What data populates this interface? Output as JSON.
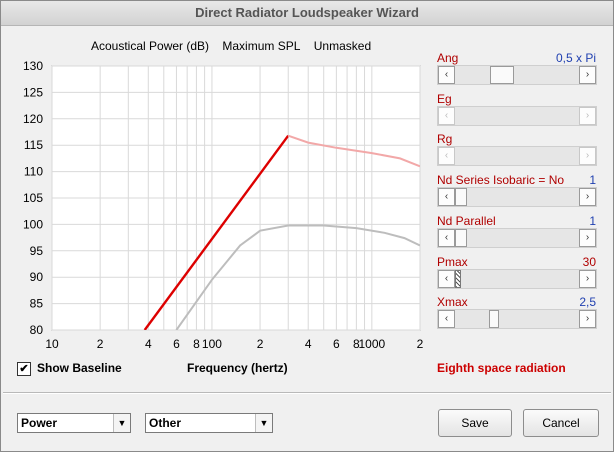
{
  "window": {
    "title": "Direct Radiator Loudspeaker Wizard"
  },
  "chart_header": {
    "item1": "Acoustical Power (dB)",
    "item2": "Maximum SPL",
    "item3": "Unmasked"
  },
  "controls": [
    {
      "label": "Ang",
      "value": "0,5 x Pi",
      "slider_position": 0.35,
      "enabled": true
    },
    {
      "label": "Eg",
      "value": "",
      "slider_position": null,
      "enabled": false
    },
    {
      "label": "Rg",
      "value": "",
      "slider_position": null,
      "enabled": false
    },
    {
      "label": "Nd Series   Isobaric = No",
      "value": "1",
      "slider_position": 0.0,
      "enabled": true
    },
    {
      "label": "Nd  Parallel",
      "value": "1",
      "slider_position": 0.0,
      "enabled": true
    },
    {
      "label": "Pmax",
      "value": "30",
      "slider_position": 0.0,
      "enabled": true
    },
    {
      "label": "Xmax",
      "value": "2,5",
      "slider_position": 0.3,
      "enabled": true
    }
  ],
  "show_baseline": {
    "label": "Show Baseline",
    "checked": true,
    "check_glyph": "✔"
  },
  "xaxis_label": "Frequency (hertz)",
  "radiation_text": "Eighth space radiation",
  "dropdowns": {
    "left": "Power",
    "right": "Other"
  },
  "buttons": {
    "save": "Save",
    "cancel": "Cancel"
  },
  "colors": {
    "red_curve": "#dd0000",
    "pink_curve": "#f2a8a8",
    "gray_curve": "#bdbdbd",
    "label_red": "#b00000",
    "value_blue": "#1f3fb0"
  },
  "chart_data": {
    "type": "line",
    "xscale": "log",
    "xlim": [
      10,
      2000
    ],
    "ylim": [
      80,
      130
    ],
    "yticks": [
      80,
      85,
      90,
      95,
      100,
      105,
      110,
      115,
      120,
      125,
      130
    ],
    "xtick_labels": [
      {
        "x": 10,
        "label": "10"
      },
      {
        "x": 20,
        "label": "2"
      },
      {
        "x": 40,
        "label": "4"
      },
      {
        "x": 60,
        "label": "6"
      },
      {
        "x": 80,
        "label": "8"
      },
      {
        "x": 100,
        "label": "100"
      },
      {
        "x": 200,
        "label": "2"
      },
      {
        "x": 400,
        "label": "4"
      },
      {
        "x": 600,
        "label": "6"
      },
      {
        "x": 800,
        "label": "8"
      },
      {
        "x": 1000,
        "label": "1000"
      },
      {
        "x": 2000,
        "label": "2"
      }
    ],
    "series": [
      {
        "color": "#dd0000",
        "points": [
          [
            38,
            80
          ],
          [
            300,
            116.8
          ]
        ]
      },
      {
        "color": "#f2a8a8",
        "points": [
          [
            300,
            116.8
          ],
          [
            400,
            115.5
          ],
          [
            600,
            114.5
          ],
          [
            1000,
            113.5
          ],
          [
            1500,
            112.5
          ],
          [
            2000,
            111
          ]
        ]
      },
      {
        "color": "#bdbdbd",
        "points": [
          [
            60,
            80
          ],
          [
            100,
            89.5
          ],
          [
            150,
            96
          ],
          [
            200,
            98.8
          ],
          [
            300,
            99.8
          ],
          [
            500,
            99.8
          ],
          [
            800,
            99.3
          ],
          [
            1200,
            98.4
          ],
          [
            1600,
            97.4
          ],
          [
            2000,
            96
          ]
        ]
      }
    ]
  }
}
